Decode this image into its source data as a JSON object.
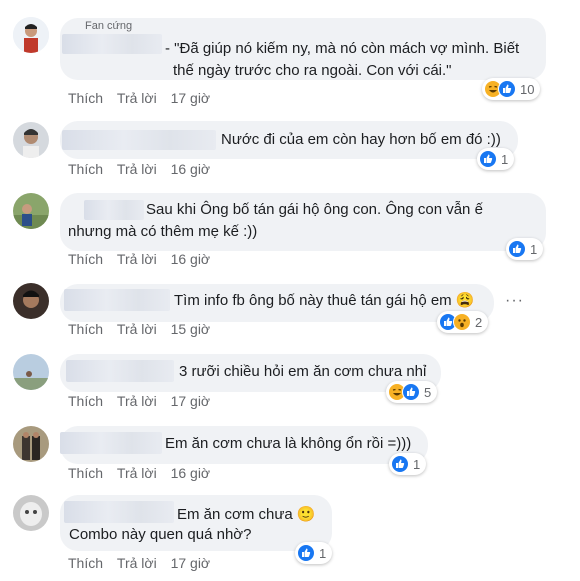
{
  "comments": [
    {
      "badge": "Fan cứng",
      "text_lines": [
        "- \"Đã giúp nó kiếm ny, mà nó còn mách vợ mình. Biết",
        "thế ngày trước cho ra ngoài. Con với cái.\""
      ],
      "like_label": "Thích",
      "reply_label": "Trả lời",
      "time": "17 giờ",
      "reactions": [
        "haha-icon",
        "like-icon"
      ],
      "reaction_count": "10"
    },
    {
      "text_lines": [
        "Nước đi của em còn hay hơn bố em đó :))"
      ],
      "like_label": "Thích",
      "reply_label": "Trả lời",
      "time": "16 giờ",
      "reactions": [
        "like-icon"
      ],
      "reaction_count": "1"
    },
    {
      "text_lines": [
        "Sau khi Ông bố tán gái hộ ông con. Ông con vẫn ế",
        "nhưng mà có thêm mẹ kế :))"
      ],
      "like_label": "Thích",
      "reply_label": "Trả lời",
      "time": "16 giờ",
      "reactions": [
        "like-icon"
      ],
      "reaction_count": "1"
    },
    {
      "text_lines": [
        "Tìm info fb ông bố này thuê tán gái hộ em 😩"
      ],
      "like_label": "Thích",
      "reply_label": "Trả lời",
      "time": "15 giờ",
      "reactions": [
        "like-icon",
        "wow-icon"
      ],
      "reaction_count": "2",
      "more": "···"
    },
    {
      "text_lines": [
        "3 rưỡi chiều hỏi em ăn cơm chưa nhỉ"
      ],
      "like_label": "Thích",
      "reply_label": "Trả lời",
      "time": "17 giờ",
      "reactions": [
        "haha-icon",
        "like-icon"
      ],
      "reaction_count": "5"
    },
    {
      "text_lines": [
        "Em ăn cơm chưa là không ổn rồi =)))"
      ],
      "like_label": "Thích",
      "reply_label": "Trả lời",
      "time": "16 giờ",
      "reactions": [
        "like-icon"
      ],
      "reaction_count": "1"
    },
    {
      "text_lines": [
        "Em ăn cơm chưa 🙂",
        "Combo này quen quá nhờ?"
      ],
      "like_label": "Thích",
      "reply_label": "Trả lời",
      "time": "17 giờ",
      "reactions": [
        "like-icon"
      ],
      "reaction_count": "1"
    }
  ],
  "colors": {
    "bubble": "#f0f2f5",
    "like": "#1877f2",
    "emoji": "#f7b125",
    "meta": "#65676b"
  }
}
